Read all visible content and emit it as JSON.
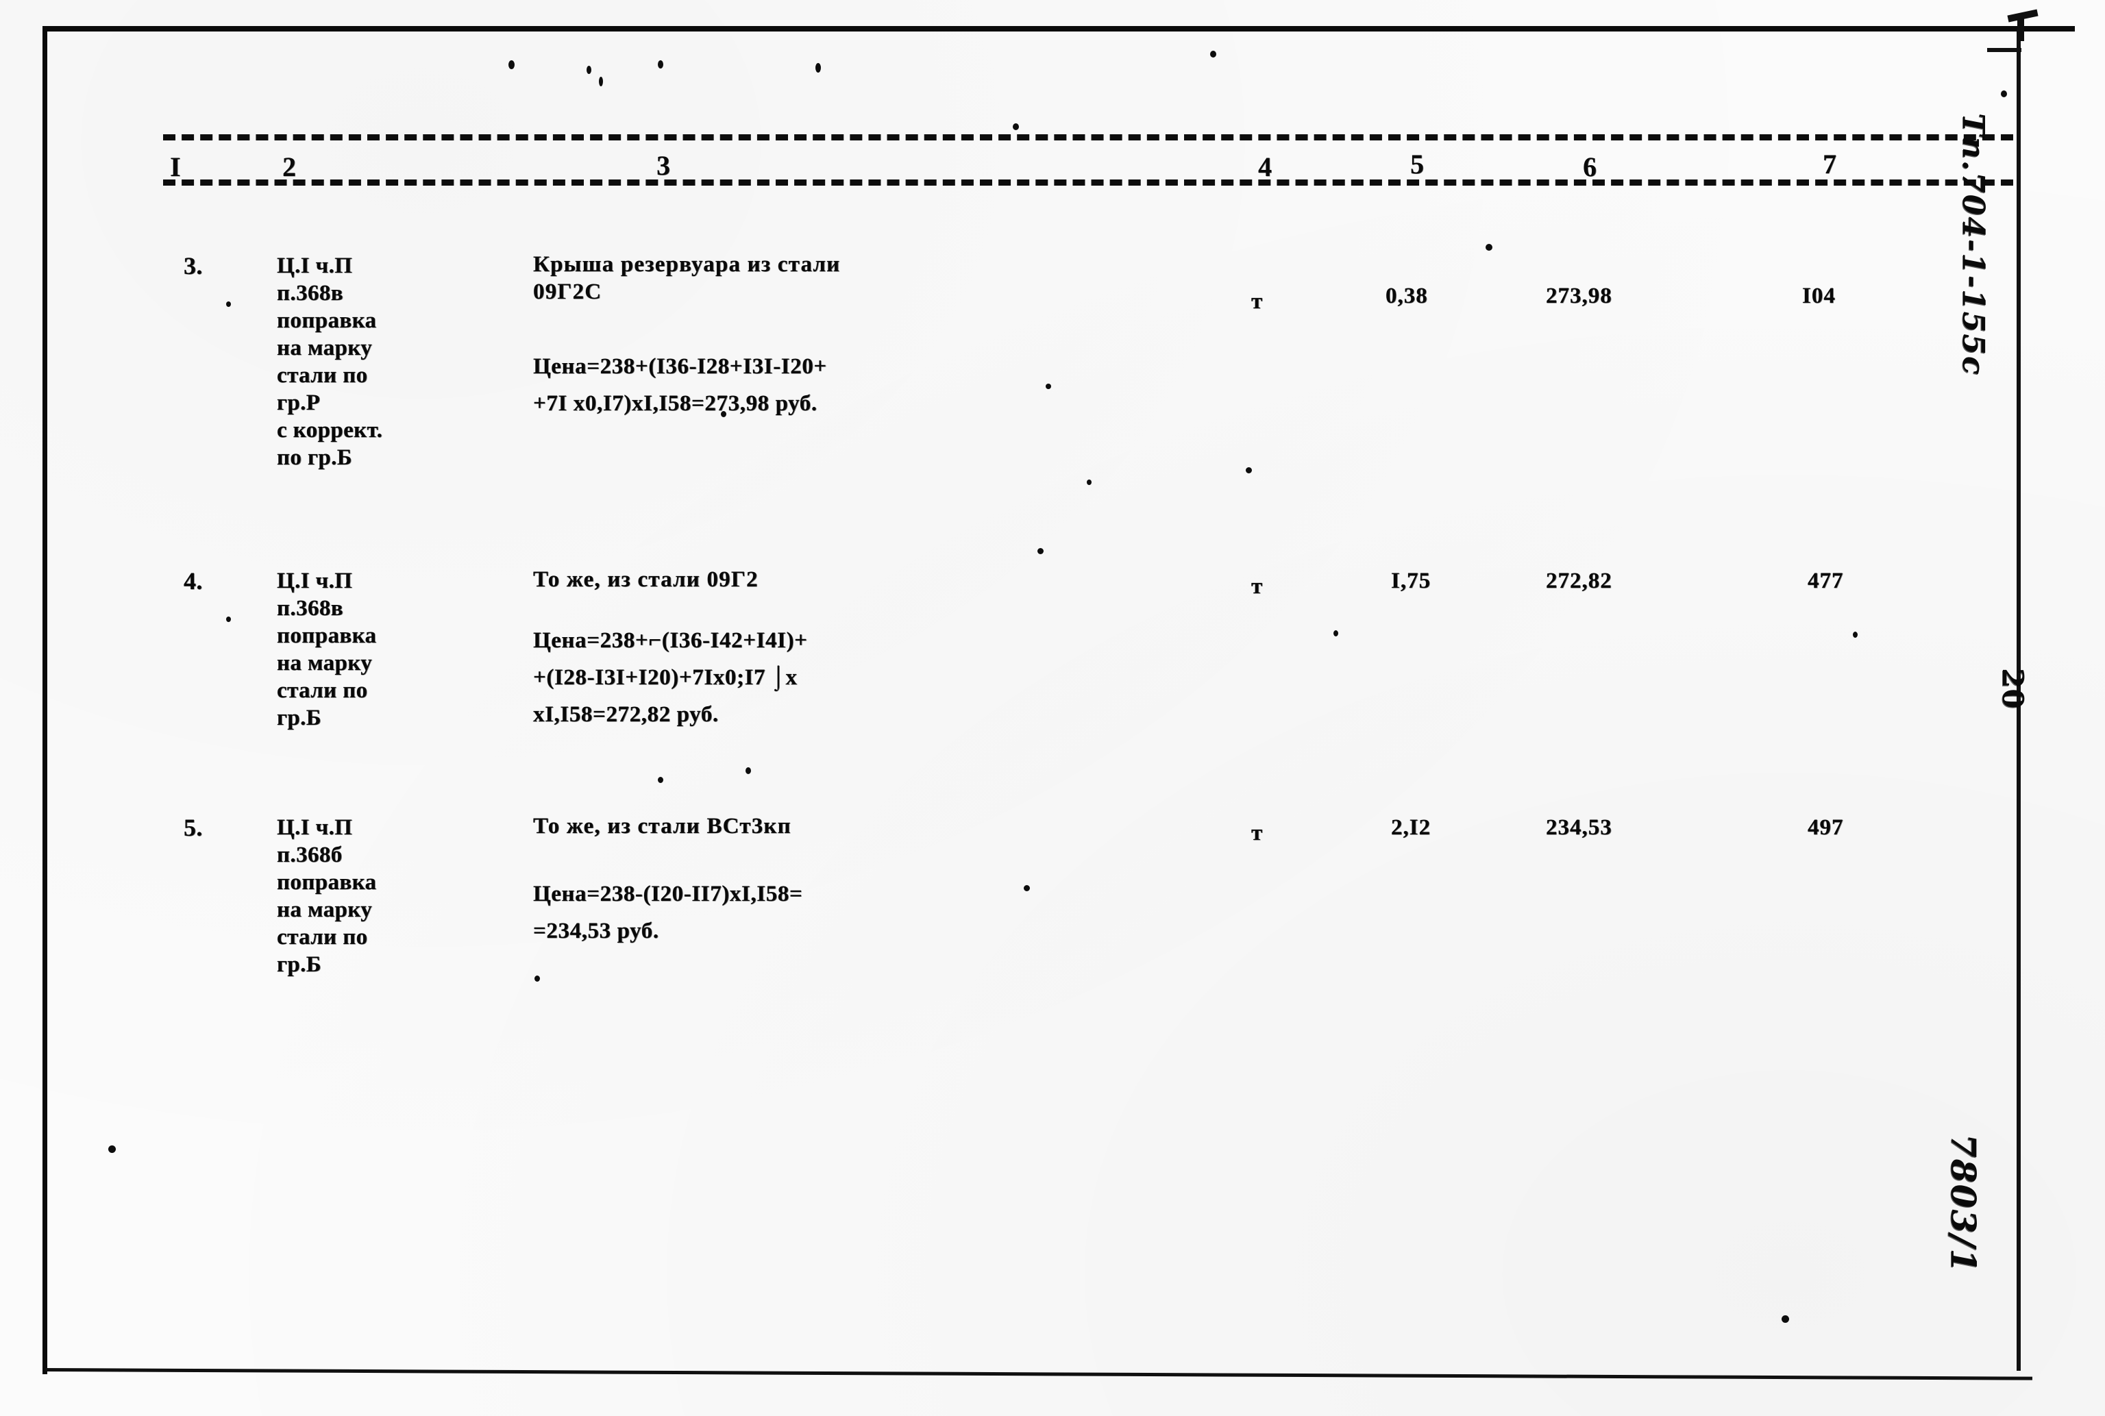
{
  "document": {
    "kind": "scanned-typewritten-table",
    "page_number": "20"
  },
  "table": {
    "column_headers": [
      "I",
      "2",
      "3",
      "4",
      "5",
      "6",
      "7"
    ],
    "rows": [
      {
        "index": "3.",
        "code": "Ц.I ч.П\nп.368в\nпоправка\nна марку\nстали по\n  гр.Р\nс коррект.\nпо гр.Б",
        "description": "Крыша резервуара из стали\n09Г2С",
        "formula": "Цена=238+(I36-I28+I3I-I20+\n+7I  х0,I7)хI,I58=273,98 руб.",
        "unit": "т",
        "quantity": "0,38",
        "price": "273,98",
        "total": "I04"
      },
      {
        "index": "4.",
        "code": "Ц.I ч.П\nп.368в\nпоправка\nна марку\nстали по\nгр.Б",
        "description": "То же, из стали 09Г2",
        "formula": "Цена=238+⌐(I36-I42+I4I)+\n+(I28-I3I+I20)+7Iх0;I7 ⌡х\nхI,I58=272,82 руб.",
        "unit": "т",
        "quantity": "I,75",
        "price": "272,82",
        "total": "477"
      },
      {
        "index": "5.",
        "code": "Ц.I ч.П\nп.368б\nпоправка\nна марку\nстали по\nгр.Б",
        "description": "То же, из стали ВСт3кп",
        "formula": "Цена=238-(I20-II7)хI,I58=\n=234,53 руб.",
        "unit": "т",
        "quantity": "2,I2",
        "price": "234,53",
        "total": "497"
      }
    ]
  },
  "margin_notes": {
    "series_code": "Тп.704-1-155с",
    "page_number": "20",
    "doc_number": "7803/1"
  }
}
